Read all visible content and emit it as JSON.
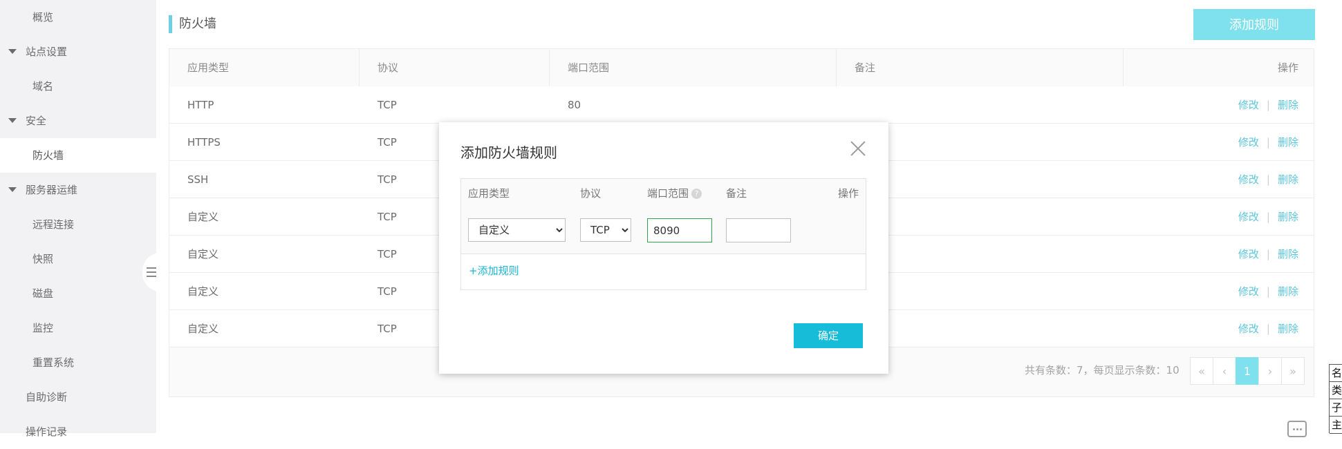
{
  "sidebar": {
    "items": [
      {
        "label": "概览",
        "level": 2,
        "expandable": false,
        "active": false
      },
      {
        "label": "站点设置",
        "level": 1,
        "expandable": true,
        "active": false
      },
      {
        "label": "域名",
        "level": 2,
        "expandable": false,
        "active": false
      },
      {
        "label": "安全",
        "level": 1,
        "expandable": true,
        "active": false
      },
      {
        "label": "防火墙",
        "level": 2,
        "expandable": false,
        "active": true
      },
      {
        "label": "服务器运维",
        "level": 1,
        "expandable": true,
        "active": false
      },
      {
        "label": "远程连接",
        "level": 2,
        "expandable": false,
        "active": false
      },
      {
        "label": "快照",
        "level": 2,
        "expandable": false,
        "active": false
      },
      {
        "label": "磁盘",
        "level": 2,
        "expandable": false,
        "active": false
      },
      {
        "label": "监控",
        "level": 2,
        "expandable": false,
        "active": false
      },
      {
        "label": "重置系统",
        "level": 2,
        "expandable": false,
        "active": false
      },
      {
        "label": "自助诊断",
        "level": 1,
        "expandable": false,
        "active": false
      },
      {
        "label": "操作记录",
        "level": 1,
        "expandable": false,
        "active": false
      }
    ]
  },
  "page": {
    "title": "防火墙",
    "add_rule_button": "添加规则"
  },
  "table": {
    "columns": [
      "应用类型",
      "协议",
      "端口范围",
      "备注",
      "操作"
    ],
    "rows": [
      {
        "app": "HTTP",
        "protocol": "TCP",
        "port": "80",
        "note": ""
      },
      {
        "app": "HTTPS",
        "protocol": "TCP",
        "port": "",
        "note": ""
      },
      {
        "app": "SSH",
        "protocol": "TCP",
        "port": "",
        "note": ""
      },
      {
        "app": "自定义",
        "protocol": "TCP",
        "port": "",
        "note": ""
      },
      {
        "app": "自定义",
        "protocol": "TCP",
        "port": "",
        "note": ""
      },
      {
        "app": "自定义",
        "protocol": "TCP",
        "port": "",
        "note": ""
      },
      {
        "app": "自定义",
        "protocol": "TCP",
        "port": "",
        "note": ""
      }
    ],
    "edit_label": "修改",
    "delete_label": "删除",
    "separator": "|"
  },
  "pagination": {
    "info": "共有条数：7，每页显示条数：10",
    "first": "«",
    "prev": "‹",
    "current": "1",
    "next": "›",
    "last": "»"
  },
  "modal": {
    "title": "添加防火墙规则",
    "columns": [
      "应用类型",
      "协议",
      "端口范围",
      "备注",
      "操作"
    ],
    "help_icon": "?",
    "app_type_value": "自定义",
    "protocol_value": "TCP",
    "port_value": "8090",
    "note_value": "",
    "add_rule_link": "+添加规则",
    "confirm_button": "确定"
  },
  "edge_fragment": {
    "cells": [
      "名",
      "类",
      "子",
      "主"
    ]
  },
  "colors": {
    "accent": "#17bcd8",
    "accent_light": "#7fe0ee",
    "link": "#5cc6dc",
    "focus_border": "#2ea44f"
  }
}
